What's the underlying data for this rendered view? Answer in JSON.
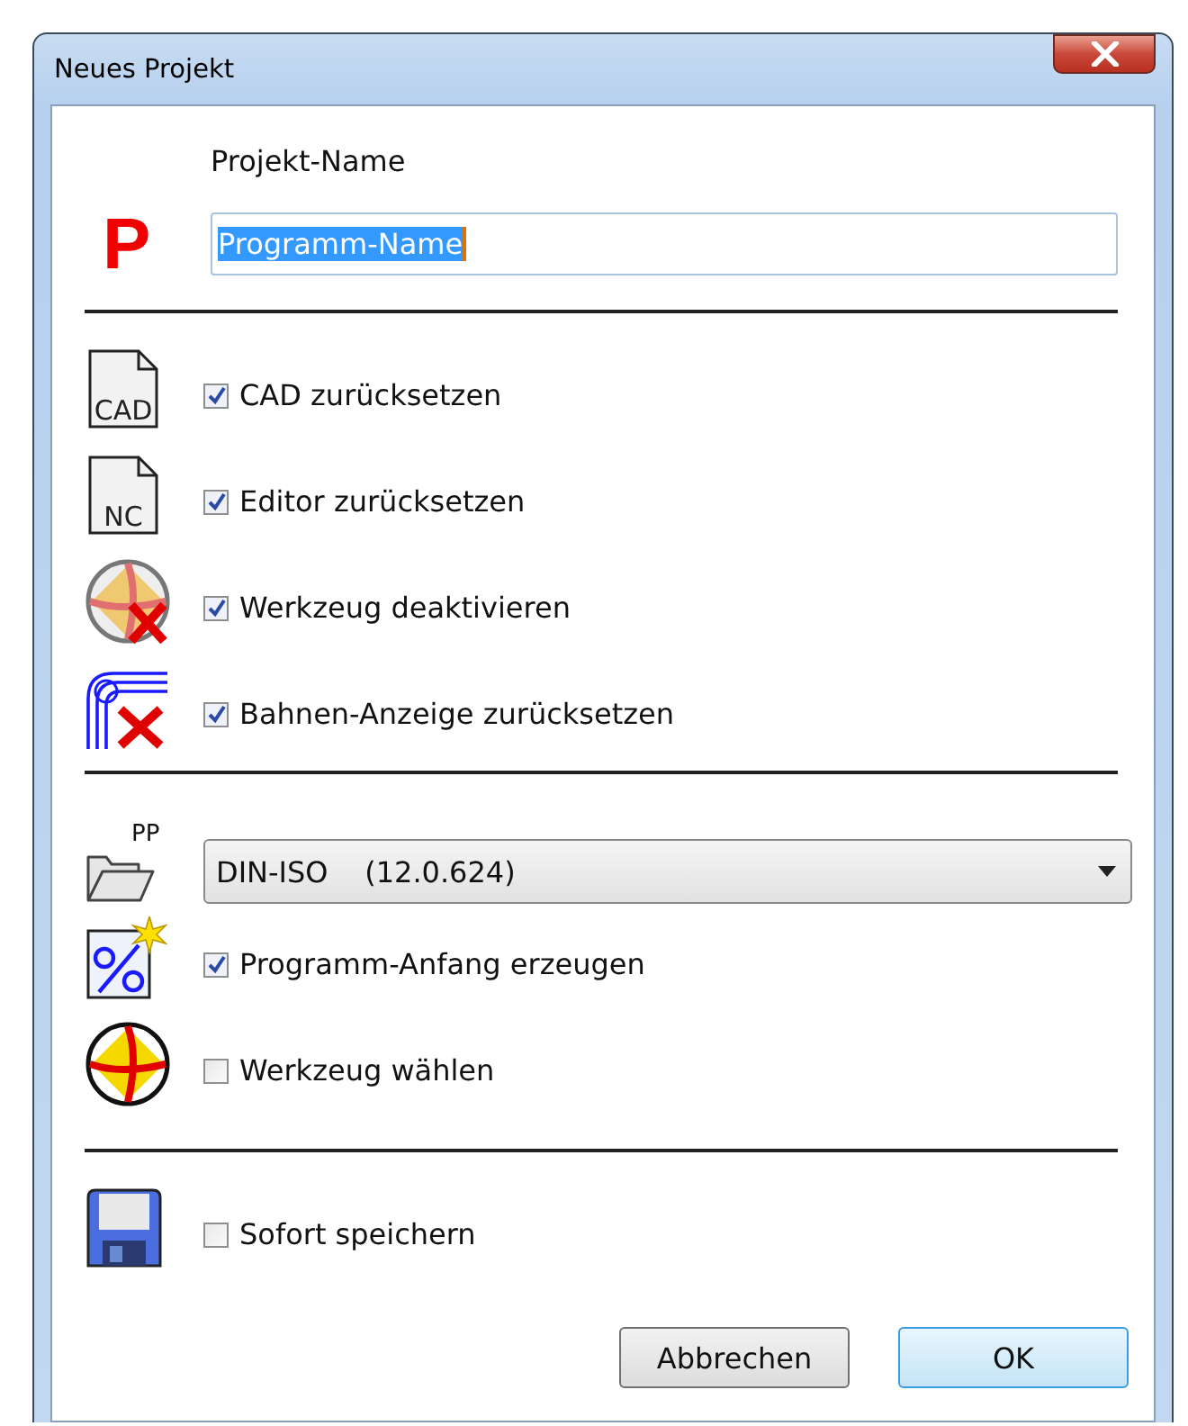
{
  "window": {
    "title": "Neues Projekt"
  },
  "project": {
    "label": "Projekt-Name",
    "icon_letter": "P",
    "value": "Programm-Name",
    "value_selected": true
  },
  "reset_options": [
    {
      "kind": "cad",
      "icon_text": "CAD",
      "label": "CAD zurücksetzen",
      "checked": true
    },
    {
      "kind": "nc",
      "icon_text": "NC",
      "label": "Editor zurücksetzen",
      "checked": true
    },
    {
      "kind": "tool-off",
      "label": "Werkzeug deaktivieren",
      "checked": true
    },
    {
      "kind": "path-off",
      "label": "Bahnen-Anzeige zurücksetzen",
      "checked": true
    }
  ],
  "postprocessor": {
    "label": "PP",
    "value": "DIN-ISO    (12.0.624)"
  },
  "start_options": [
    {
      "kind": "program-start",
      "label": "Programm-Anfang erzeugen",
      "checked": true
    },
    {
      "kind": "tool-select",
      "label": "Werkzeug wählen",
      "checked": false
    }
  ],
  "save_options": [
    {
      "kind": "save",
      "label": "Sofort speichern",
      "checked": false
    }
  ],
  "buttons": [
    {
      "label": "Abbrechen",
      "default": false
    },
    {
      "label": "OK",
      "default": true
    }
  ]
}
